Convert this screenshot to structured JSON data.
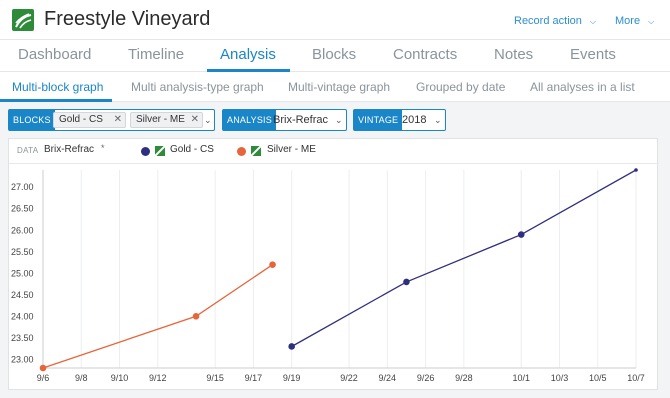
{
  "header": {
    "title": "Freestyle Vineyard",
    "record_action": "Record action",
    "more": "More"
  },
  "tabs": [
    {
      "label": "Dashboard"
    },
    {
      "label": "Timeline"
    },
    {
      "label": "Analysis",
      "active": true
    },
    {
      "label": "Blocks"
    },
    {
      "label": "Contracts"
    },
    {
      "label": "Notes"
    },
    {
      "label": "Events"
    }
  ],
  "subtabs": [
    {
      "label": "Multi-block graph",
      "active": true
    },
    {
      "label": "Multi analysis-type graph"
    },
    {
      "label": "Multi-vintage graph"
    },
    {
      "label": "Grouped by date"
    },
    {
      "label": "All analyses in a list"
    }
  ],
  "filters": {
    "blocks_label": "BLOCKS",
    "blocks_selected": [
      "Gold - CS",
      "Silver - ME"
    ],
    "analysis_label": "ANALYSIS",
    "analysis_value": "Brix-Refrac",
    "vintage_label": "VINTAGE",
    "vintage_value": "2018"
  },
  "legend": {
    "data_label": "DATA",
    "data_value": "Brix-Refrac",
    "data_marker": "*"
  },
  "colors": {
    "accent": "#1a86c8",
    "brand": "#2e8b3a",
    "gold_cs": "#2f2f7f",
    "silver_me": "#e8643a"
  },
  "chart_data": {
    "type": "line",
    "x_ticks": [
      "9/6",
      "9/8",
      "9/10",
      "9/12",
      "9/15",
      "9/17",
      "9/19",
      "9/22",
      "9/24",
      "9/26",
      "9/28",
      "10/1",
      "10/3",
      "10/5",
      "10/7"
    ],
    "y_ticks": [
      "23.00",
      "23.50",
      "24.00",
      "24.50",
      "25.00",
      "25.50",
      "26.00",
      "26.50",
      "27.00"
    ],
    "ylim": [
      22.8,
      27.4
    ],
    "series": [
      {
        "name": "Gold - CS",
        "color": "#2f2f7f",
        "points": [
          {
            "x": "2018-09-19",
            "y": 23.3
          },
          {
            "x": "2018-09-25",
            "y": 24.8
          },
          {
            "x": "2018-10-01",
            "y": 25.9
          },
          {
            "x": "2018-10-07",
            "y": 27.4
          }
        ]
      },
      {
        "name": "Silver - ME",
        "color": "#e8643a",
        "points": [
          {
            "x": "2018-09-06",
            "y": 22.8
          },
          {
            "x": "2018-09-14",
            "y": 24.0
          },
          {
            "x": "2018-09-18",
            "y": 25.2
          }
        ]
      }
    ]
  }
}
